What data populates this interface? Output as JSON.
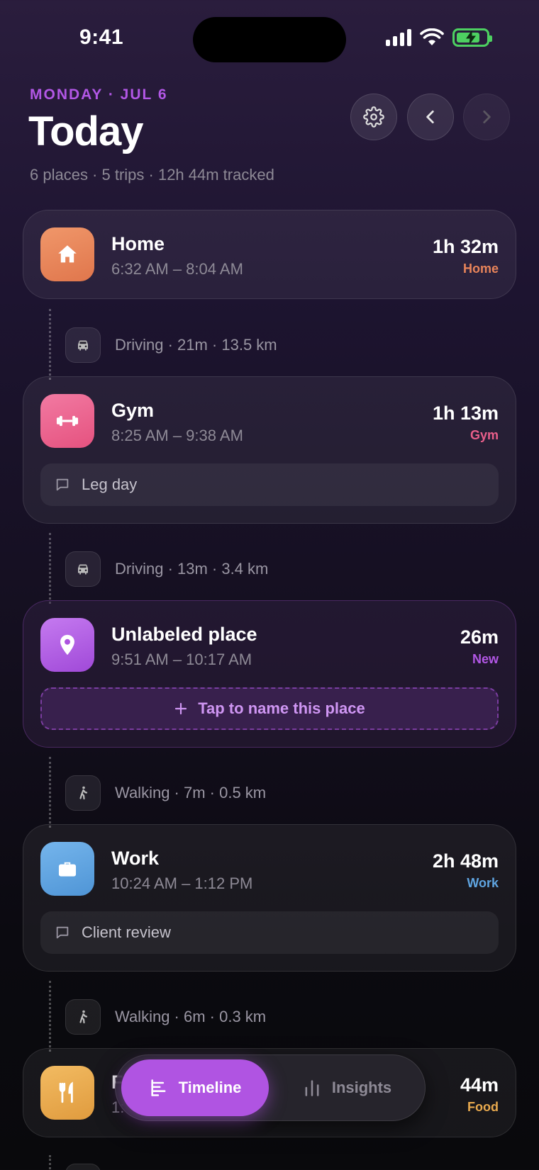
{
  "status_bar": {
    "time": "9:41"
  },
  "header": {
    "date": "MONDAY · JUL 6",
    "title": "Today",
    "summary": "6 places · 5 trips · 12h 44m tracked"
  },
  "places": [
    {
      "name": "Home",
      "time": "6:32 AM – 8:04 AM",
      "duration": "1h 32m",
      "tag": "Home",
      "icon": "home-icon",
      "color": "#e8845a"
    },
    {
      "name": "Gym",
      "time": "8:25 AM – 9:38 AM",
      "duration": "1h 13m",
      "tag": "Gym",
      "icon": "dumbbell-icon",
      "color": "#ea5f8b",
      "note": "Leg day"
    },
    {
      "name": "Unlabeled place",
      "time": "9:51 AM – 10:17 AM",
      "duration": "26m",
      "tag": "New",
      "icon": "location-pin-icon",
      "color": "#b257e6",
      "action": "Tap to name this place"
    },
    {
      "name": "Work",
      "time": "10:24 AM – 1:12 PM",
      "duration": "2h 48m",
      "tag": "Work",
      "icon": "briefcase-icon",
      "color": "#5fa4e0",
      "note": "Client review"
    },
    {
      "name": "F",
      "time": "1:",
      "duration": "44m",
      "tag": "Food",
      "icon": "fork-knife-icon",
      "color": "#e8a94e"
    }
  ],
  "trips": [
    {
      "text": "Driving · 21m · 13.5 km",
      "icon": "car-icon"
    },
    {
      "text": "Driving · 13m · 3.4 km",
      "icon": "car-icon"
    },
    {
      "text": "Walking · 7m · 0.5 km",
      "icon": "walking-icon"
    },
    {
      "text": "Walking · 6m · 0.3 km",
      "icon": "walking-icon"
    }
  ],
  "tabs": [
    {
      "label": "Timeline",
      "icon": "timeline-icon",
      "active": true
    },
    {
      "label": "Insights",
      "icon": "bar-chart-icon",
      "active": false
    }
  ],
  "colors": {
    "accent": "#b054e2",
    "new_tag": "#b257e6"
  }
}
